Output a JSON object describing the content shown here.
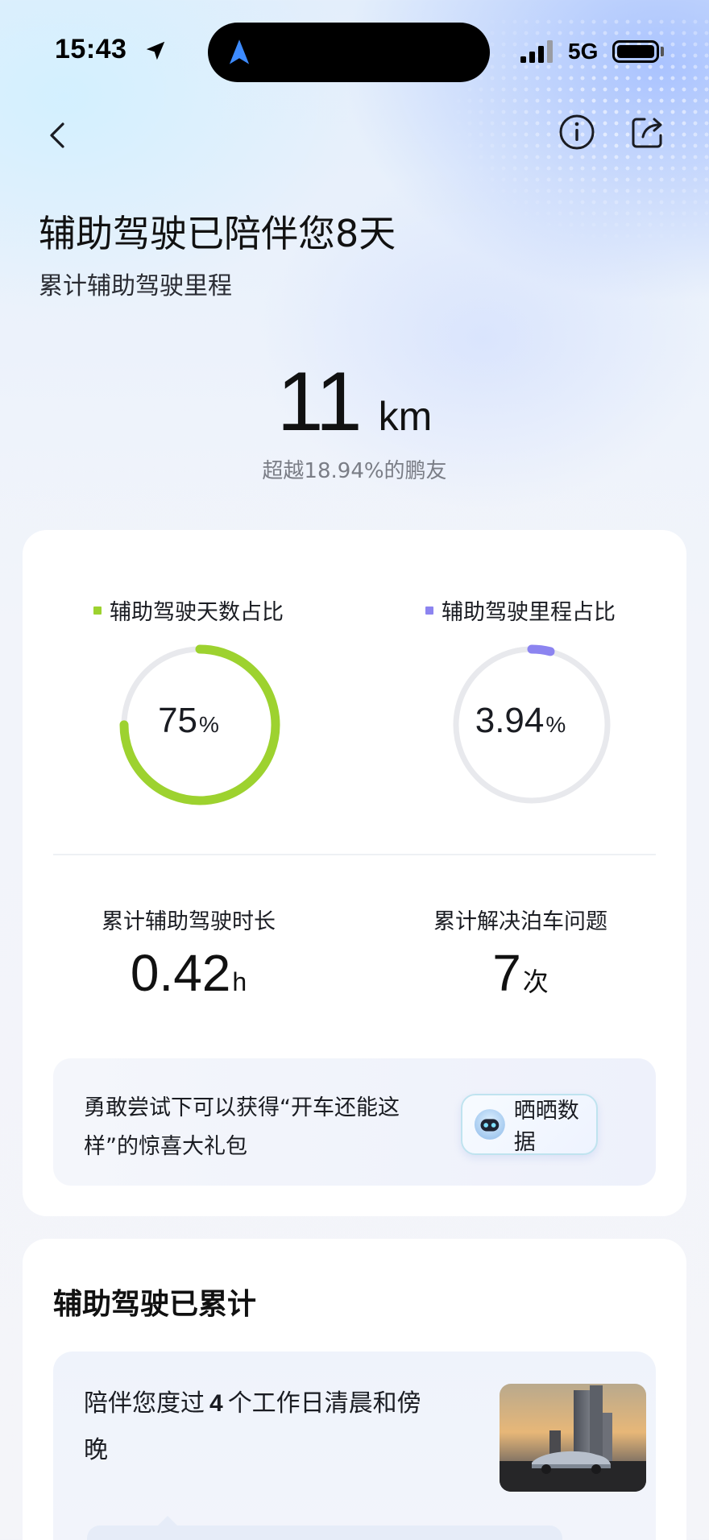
{
  "status_bar": {
    "time": "15:43",
    "network": "5G",
    "icons": [
      "location-arrow-icon",
      "navigation-icon",
      "signal-icon",
      "battery-icon"
    ]
  },
  "nav": {
    "icons": [
      "back-icon",
      "info-icon",
      "share-icon"
    ]
  },
  "hero": {
    "title": "辅助驾驶已陪伴您8天",
    "subtitle": "累计辅助驾驶里程",
    "mileage_value": "11",
    "mileage_unit": "km",
    "rank_text": "超越18.94%的鹏友"
  },
  "ratios": [
    {
      "label": "辅助驾驶天数占比",
      "value": "75",
      "unit": "%",
      "fraction": 0.75,
      "color": "#9dd22f"
    },
    {
      "label": "辅助驾驶里程占比",
      "value": "3.94",
      "unit": "%",
      "fraction": 0.0394,
      "color": "#8c84f0"
    }
  ],
  "ring_track_color": "#e8e9ed",
  "stats": [
    {
      "label": "累计辅助驾驶时长",
      "value": "0.42",
      "unit": "h"
    },
    {
      "label": "累计解决泊车问题",
      "value": "7",
      "unit": "次"
    }
  ],
  "promo": {
    "text": "勇敢尝试下可以获得“开车还能这样”的惊喜大礼包",
    "button_label": "晒晒数据"
  },
  "summary": {
    "title": "辅助驾驶已累计",
    "item_prefix": "陪伴您度过",
    "item_count": "4",
    "item_suffix": "个工作日清晨和傍晚"
  }
}
